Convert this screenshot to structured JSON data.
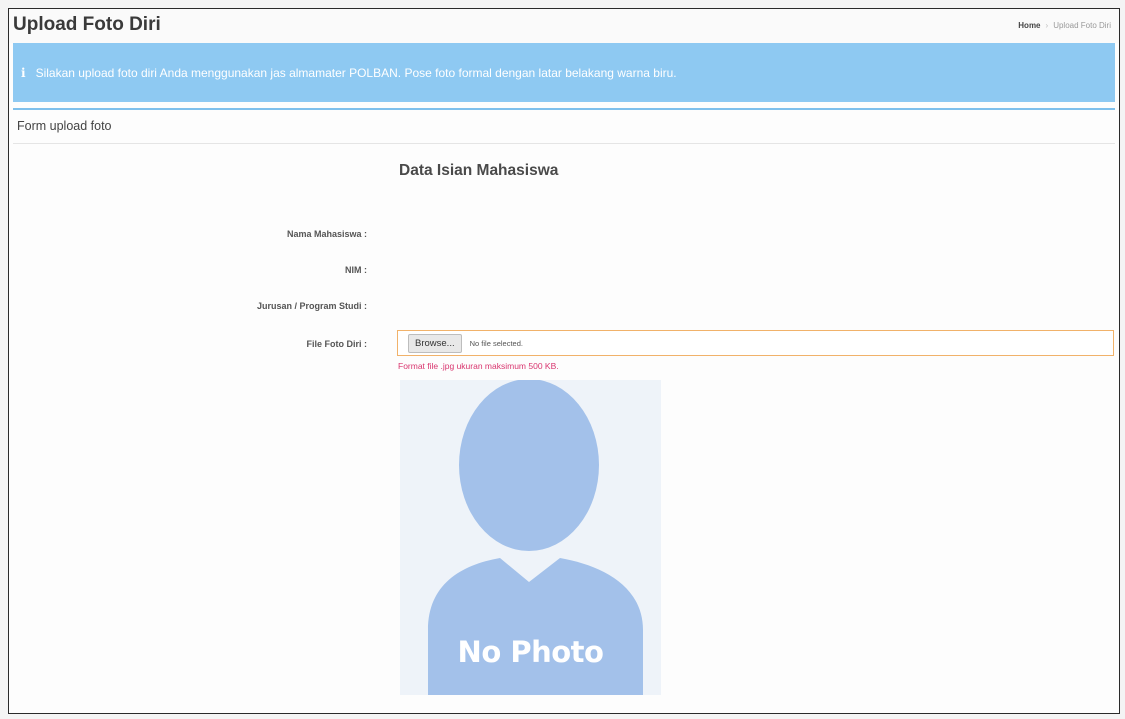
{
  "header": {
    "title": "Upload Foto Diri",
    "breadcrumb": {
      "home": "Home",
      "current": "Upload Foto Diri"
    }
  },
  "alert": {
    "icon": "info-icon",
    "text": "Silakan upload foto diri Anda menggunakan jas almamater POLBAN. Pose foto formal dengan latar belakang warna biru."
  },
  "panel": {
    "heading": "Form upload foto"
  },
  "form": {
    "title": "Data Isian Mahasiswa",
    "fields": {
      "nama": "Nama Mahasiswa :",
      "nim": "NIM :",
      "jurusan": "Jurusan / Program Studi :",
      "file": "File Foto Diri :"
    },
    "file_input": {
      "button_label": "Browse...",
      "status": "No file selected."
    },
    "hint": "Format file .jpg ukuran maksimum 500 KB."
  },
  "photo": {
    "label": "No Photo",
    "icon": "user-silhouette-icon"
  },
  "colors": {
    "alert_bg": "#8ec9f2",
    "accent_line": "#7fc0ec",
    "hint": "#d9366f",
    "file_border": "#f1b26a",
    "silhouette": "#a3c1ea"
  }
}
